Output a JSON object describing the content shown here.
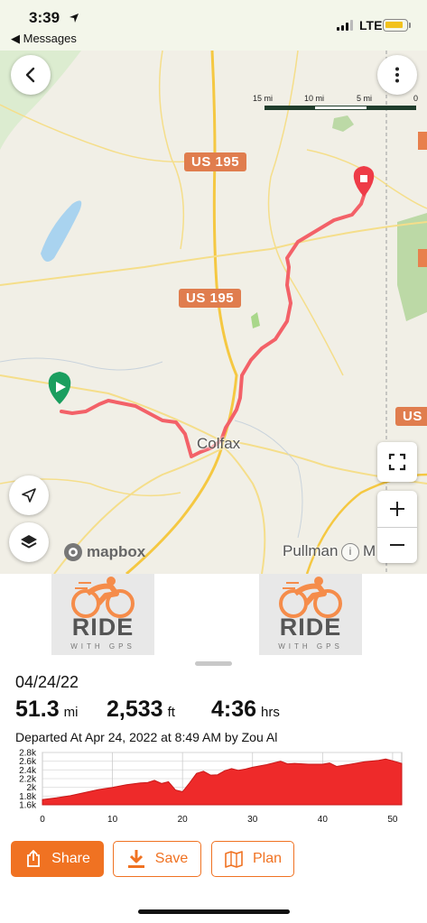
{
  "status_bar": {
    "time": "3:39",
    "location_icon": "location-arrow-icon",
    "back_app": "◀ Messages",
    "network": "LTE",
    "battery_color": "#f2c21c"
  },
  "map": {
    "scale_labels": [
      "15 mi",
      "10 mi",
      "5 mi",
      "0"
    ],
    "road_shields": [
      "US 195",
      "US 195",
      "US"
    ],
    "towns": [
      "Colfax",
      "Pullman",
      "M"
    ],
    "attribution": "mapbox",
    "info": "i",
    "route_color": "#f36168",
    "start_marker_color": "#1a9e5f",
    "end_marker_color": "#ee3b47",
    "controls": {
      "back": "chevron-left-icon",
      "more": "more-vertical-icon",
      "locate": "navigation-arrow-icon",
      "layers": "layers-icon",
      "fullscreen": "fullscreen-icon",
      "zoom_in": "+",
      "zoom_out": "−"
    }
  },
  "images": [
    {
      "title": "RIDE",
      "subtitle": "WITH GPS"
    },
    {
      "title": "RIDE",
      "subtitle": "WITH GPS"
    }
  ],
  "ride": {
    "date": "04/24/22",
    "distance": {
      "value": "51.3",
      "unit": "mi"
    },
    "elevation": {
      "value": "2,533",
      "unit": "ft"
    },
    "duration": {
      "value": "4:36",
      "unit": "hrs"
    },
    "departed": "Departed At Apr 24, 2022 at 8:49 AM by Zou Al"
  },
  "chart_data": {
    "type": "area",
    "title": "",
    "xlabel": "",
    "ylabel": "",
    "x_ticks": [
      "0",
      "10",
      "20",
      "30",
      "40",
      "50"
    ],
    "y_ticks": [
      "1.6k",
      "1.8k",
      "2k",
      "2.2k",
      "2.4k",
      "2.6k",
      "2.8k"
    ],
    "xlim": [
      0,
      51.3
    ],
    "ylim": [
      1600,
      2800
    ],
    "fill_color": "#ee2a2a",
    "series": [
      {
        "x": [
          0,
          2,
          4,
          6,
          8,
          10,
          12,
          14,
          15,
          16,
          17,
          18,
          19,
          20,
          21,
          22,
          23,
          24,
          25,
          26,
          27,
          28,
          29,
          30,
          32,
          34,
          35,
          36,
          38,
          40,
          41,
          42,
          44,
          46,
          48,
          49,
          50,
          51.3
        ],
        "values": [
          1720,
          1760,
          1810,
          1880,
          1950,
          2000,
          2060,
          2100,
          2110,
          2160,
          2090,
          2130,
          1940,
          1900,
          2100,
          2320,
          2370,
          2280,
          2290,
          2380,
          2430,
          2390,
          2420,
          2460,
          2520,
          2600,
          2540,
          2550,
          2530,
          2530,
          2560,
          2480,
          2530,
          2590,
          2620,
          2650,
          2610,
          2550
        ]
      }
    ]
  },
  "actions": {
    "share": {
      "label": "Share",
      "icon": "share-icon"
    },
    "save": {
      "label": "Save",
      "icon": "download-icon"
    },
    "plan": {
      "label": "Plan",
      "icon": "map-pin-icon"
    }
  }
}
